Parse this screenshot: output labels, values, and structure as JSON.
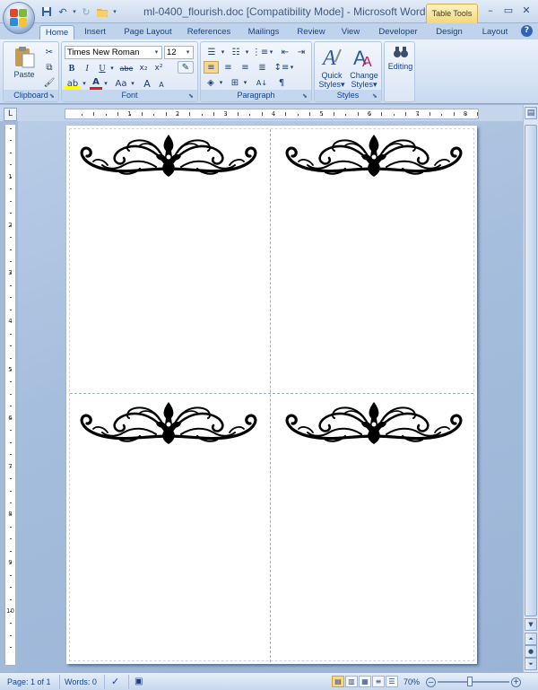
{
  "window": {
    "title": "ml-0400_flourish.doc [Compatibility Mode] - Microsoft Word",
    "context_tab": "Table Tools"
  },
  "tabs": [
    "Home",
    "Insert",
    "Page Layout",
    "References",
    "Mailings",
    "Review",
    "View",
    "Developer",
    "Design",
    "Layout"
  ],
  "active_tab": "Home",
  "ribbon": {
    "clipboard": {
      "label": "Clipboard",
      "paste": "Paste"
    },
    "font": {
      "label": "Font",
      "name": "Times New Roman",
      "size": "12",
      "bold": "B",
      "italic": "I",
      "underline": "U",
      "strike": "abe",
      "sub": "x₂",
      "sup": "x²",
      "change_case": "Aa",
      "grow": "A",
      "shrink": "A"
    },
    "paragraph": {
      "label": "Paragraph"
    },
    "styles": {
      "label": "Styles",
      "quick_styles": "Quick",
      "quick_styles2": "Styles",
      "change_styles": "Change",
      "change_styles2": "Styles"
    },
    "editing": {
      "label": "Editing"
    }
  },
  "ruler": {
    "h_numbers": [
      "1",
      "2",
      "3",
      "4",
      "5",
      "6",
      "7",
      "8"
    ],
    "v_numbers": [
      "1",
      "2",
      "3",
      "4",
      "5",
      "6",
      "7",
      "8",
      "9",
      "10"
    ]
  },
  "status": {
    "page": "Page: 1 of 1",
    "words": "Words: 0",
    "zoom": "70%"
  },
  "colors": {
    "accent": "#15428b",
    "ribbon": "#dbe6f5",
    "doc_bg": "#a6bedd"
  }
}
